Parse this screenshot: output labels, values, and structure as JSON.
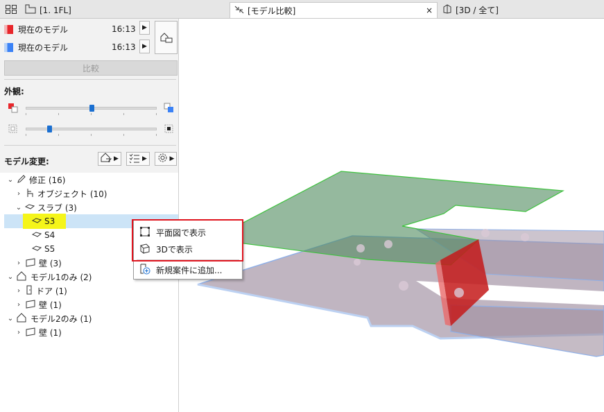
{
  "tabs": [
    {
      "label": "[1. 1FL]"
    },
    {
      "label": "[モデル比較]",
      "close": "×"
    },
    {
      "label": "[3D / 全て]"
    }
  ],
  "models": [
    {
      "label": "現在のモデル",
      "time": "16:13",
      "color": "#e8262b"
    },
    {
      "label": "現在のモデル",
      "time": "16:13",
      "color": "#3b82f6"
    }
  ],
  "compare_button": "比較",
  "appearance": {
    "title": "外観:",
    "slider1_level": 0.5,
    "slider2_level": 0.18
  },
  "changes": {
    "title": "モデル変更:"
  },
  "tree": {
    "modified": "修正 (16)",
    "objects": "オブジェクト (10)",
    "slabs": "スラブ (3)",
    "s3": "S3",
    "s4": "S4",
    "s5": "S5",
    "walls": "壁 (3)",
    "model1_only": "モデル1のみ (2)",
    "doors": "ドア (1)",
    "walls_m1": "壁 (1)",
    "model2_only": "モデル2のみ (1)",
    "walls_m2": "壁 (1)"
  },
  "context_menu": {
    "show_in_plan": "平面図で表示",
    "show_in_3d": "3Dで表示",
    "add_to_new_issue": "新規案件に追加..."
  },
  "colors": {
    "accent": "#1a6fd1",
    "highlight": "#f5f51a",
    "selection": "#cce4f7",
    "callout": "#e0141e",
    "slab_new": "#3ec23e",
    "changed_wall": "#c41a1a"
  }
}
